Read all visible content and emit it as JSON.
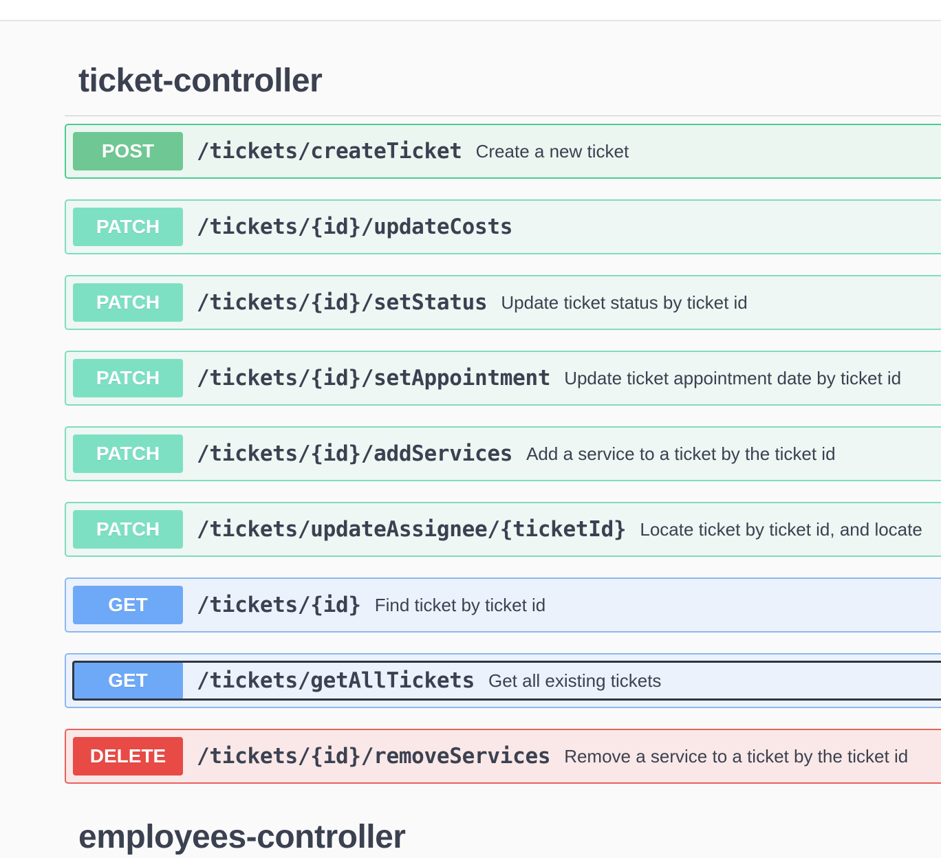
{
  "colors": {
    "post": {
      "badge": "#6fc894",
      "border": "#49cc90",
      "bg": "#ecf6f0"
    },
    "patch": {
      "badge": "#7ee0c3",
      "border": "#7fdcbf",
      "bg": "#eef7f3"
    },
    "get": {
      "badge": "#6ea9f7",
      "border": "#8cb8ef",
      "bg": "#ecf2fc"
    },
    "delete": {
      "badge": "#e84a45",
      "border": "#e8605b",
      "bg": "#f9e8e7"
    }
  },
  "sections": [
    {
      "title": "ticket-controller"
    },
    {
      "title": "employees-controller"
    }
  ],
  "operations": [
    {
      "method": "POST",
      "kind": "post",
      "path": "/tickets/createTicket",
      "description": "Create a new ticket"
    },
    {
      "method": "PATCH",
      "kind": "patch",
      "path": "/tickets/{id}/updateCosts",
      "description": ""
    },
    {
      "method": "PATCH",
      "kind": "patch",
      "path": "/tickets/{id}/setStatus",
      "description": "Update ticket status by ticket id"
    },
    {
      "method": "PATCH",
      "kind": "patch",
      "path": "/tickets/{id}/setAppointment",
      "description": "Update ticket appointment date by ticket id"
    },
    {
      "method": "PATCH",
      "kind": "patch",
      "path": "/tickets/{id}/addServices",
      "description": "Add a service to a ticket by the ticket id"
    },
    {
      "method": "PATCH",
      "kind": "patch",
      "path": "/tickets/updateAssignee/{ticketId}",
      "description": "Locate ticket by ticket id, and locate"
    },
    {
      "method": "GET",
      "kind": "get",
      "path": "/tickets/{id}",
      "description": "Find ticket by ticket id"
    },
    {
      "method": "GET",
      "kind": "get",
      "path": "/tickets/getAllTickets",
      "description": "Get all existing tickets",
      "focused": true
    },
    {
      "method": "DELETE",
      "kind": "delete",
      "path": "/tickets/{id}/removeServices",
      "description": "Remove a service to a ticket by the ticket id"
    }
  ]
}
